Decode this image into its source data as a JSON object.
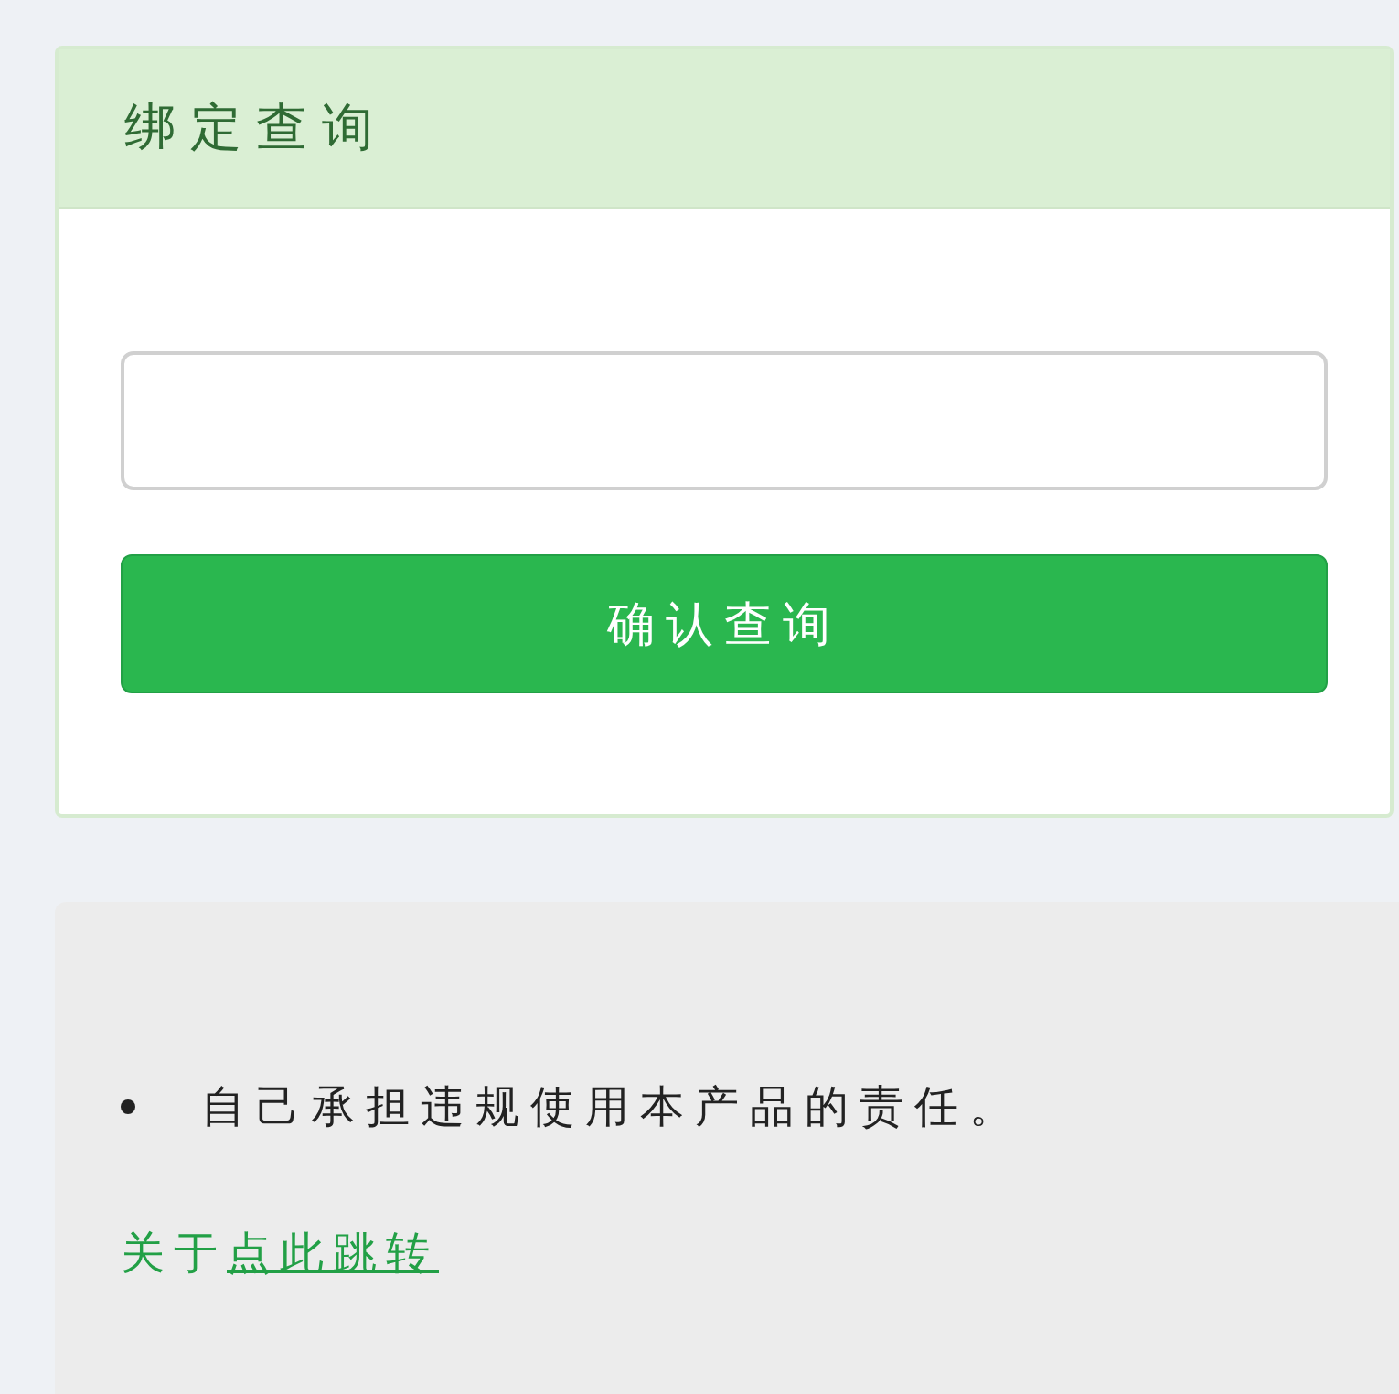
{
  "card": {
    "title": "绑定查询",
    "button": "确认查询"
  },
  "notice": {
    "items": [
      "自己承担违规使用本产品的责任。"
    ],
    "about": {
      "label": "关于",
      "link": "点此跳转"
    }
  }
}
